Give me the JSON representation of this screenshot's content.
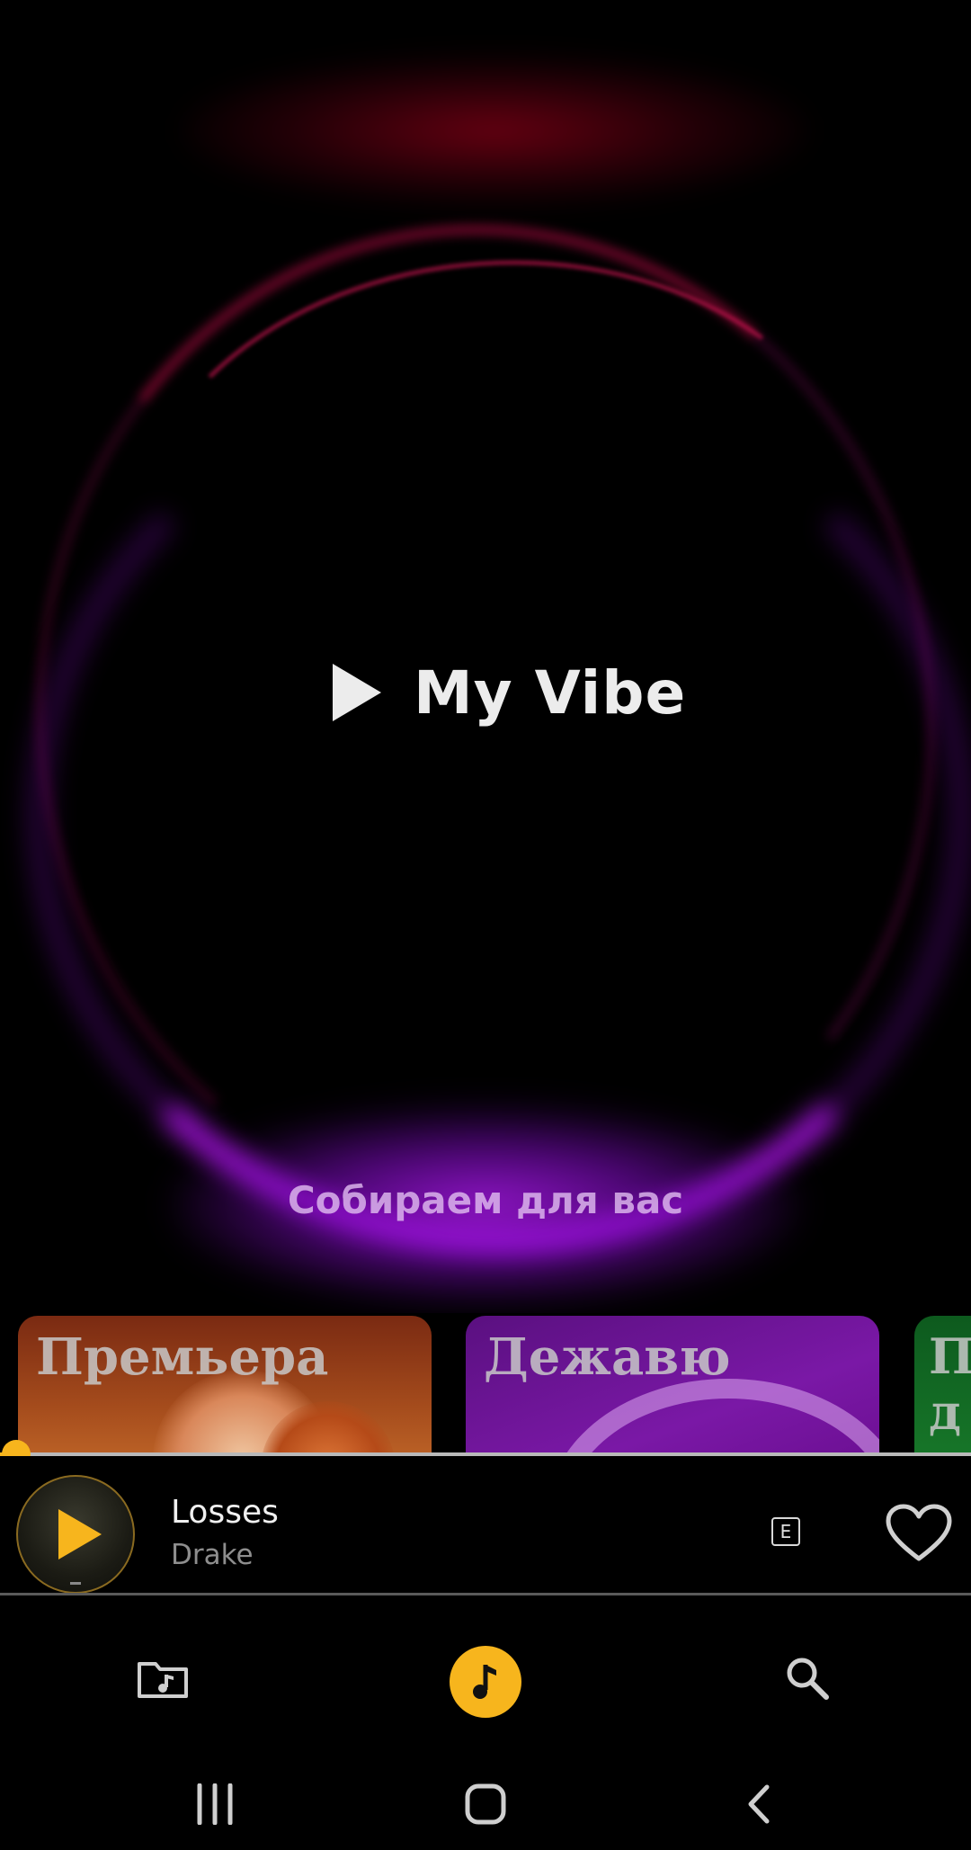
{
  "vibe": {
    "title": "My Vibe",
    "status": "Собираем для вас"
  },
  "cards": [
    {
      "title": "Премьера"
    },
    {
      "title": "Дежавю"
    },
    {
      "title": "П\nд"
    }
  ],
  "player": {
    "track_title": "Losses",
    "artist": "Drake",
    "explicit_badge": "E",
    "progress_percent": 1.7
  },
  "bottom_nav": {
    "items": [
      "library-icon",
      "music-note-icon",
      "search-icon"
    ],
    "active": "music-note-icon"
  },
  "system_nav": {
    "items": [
      "recents-icon",
      "home-icon",
      "back-icon"
    ]
  },
  "colors": {
    "accent": "#f7b51d",
    "background": "#000000",
    "vibe_purple": "#aa14e6",
    "vibe_red": "#a00a3c"
  }
}
